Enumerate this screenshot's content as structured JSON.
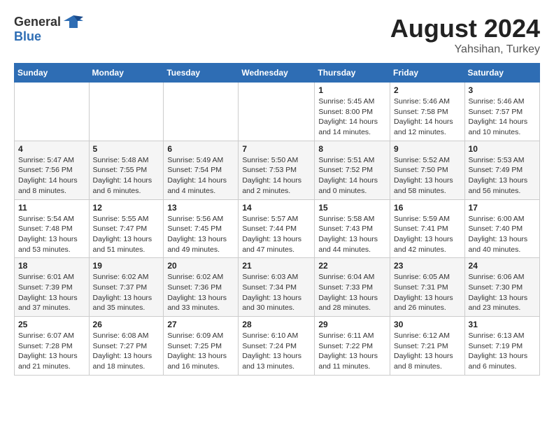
{
  "header": {
    "logo_general": "General",
    "logo_blue": "Blue",
    "title": "August 2024",
    "location": "Yahsihan, Turkey"
  },
  "weekdays": [
    "Sunday",
    "Monday",
    "Tuesday",
    "Wednesday",
    "Thursday",
    "Friday",
    "Saturday"
  ],
  "weeks": [
    [
      {
        "day": "",
        "sunrise": "",
        "sunset": "",
        "daylight": ""
      },
      {
        "day": "",
        "sunrise": "",
        "sunset": "",
        "daylight": ""
      },
      {
        "day": "",
        "sunrise": "",
        "sunset": "",
        "daylight": ""
      },
      {
        "day": "",
        "sunrise": "",
        "sunset": "",
        "daylight": ""
      },
      {
        "day": "1",
        "sunrise": "Sunrise: 5:45 AM",
        "sunset": "Sunset: 8:00 PM",
        "daylight": "Daylight: 14 hours and 14 minutes."
      },
      {
        "day": "2",
        "sunrise": "Sunrise: 5:46 AM",
        "sunset": "Sunset: 7:58 PM",
        "daylight": "Daylight: 14 hours and 12 minutes."
      },
      {
        "day": "3",
        "sunrise": "Sunrise: 5:46 AM",
        "sunset": "Sunset: 7:57 PM",
        "daylight": "Daylight: 14 hours and 10 minutes."
      }
    ],
    [
      {
        "day": "4",
        "sunrise": "Sunrise: 5:47 AM",
        "sunset": "Sunset: 7:56 PM",
        "daylight": "Daylight: 14 hours and 8 minutes."
      },
      {
        "day": "5",
        "sunrise": "Sunrise: 5:48 AM",
        "sunset": "Sunset: 7:55 PM",
        "daylight": "Daylight: 14 hours and 6 minutes."
      },
      {
        "day": "6",
        "sunrise": "Sunrise: 5:49 AM",
        "sunset": "Sunset: 7:54 PM",
        "daylight": "Daylight: 14 hours and 4 minutes."
      },
      {
        "day": "7",
        "sunrise": "Sunrise: 5:50 AM",
        "sunset": "Sunset: 7:53 PM",
        "daylight": "Daylight: 14 hours and 2 minutes."
      },
      {
        "day": "8",
        "sunrise": "Sunrise: 5:51 AM",
        "sunset": "Sunset: 7:52 PM",
        "daylight": "Daylight: 14 hours and 0 minutes."
      },
      {
        "day": "9",
        "sunrise": "Sunrise: 5:52 AM",
        "sunset": "Sunset: 7:50 PM",
        "daylight": "Daylight: 13 hours and 58 minutes."
      },
      {
        "day": "10",
        "sunrise": "Sunrise: 5:53 AM",
        "sunset": "Sunset: 7:49 PM",
        "daylight": "Daylight: 13 hours and 56 minutes."
      }
    ],
    [
      {
        "day": "11",
        "sunrise": "Sunrise: 5:54 AM",
        "sunset": "Sunset: 7:48 PM",
        "daylight": "Daylight: 13 hours and 53 minutes."
      },
      {
        "day": "12",
        "sunrise": "Sunrise: 5:55 AM",
        "sunset": "Sunset: 7:47 PM",
        "daylight": "Daylight: 13 hours and 51 minutes."
      },
      {
        "day": "13",
        "sunrise": "Sunrise: 5:56 AM",
        "sunset": "Sunset: 7:45 PM",
        "daylight": "Daylight: 13 hours and 49 minutes."
      },
      {
        "day": "14",
        "sunrise": "Sunrise: 5:57 AM",
        "sunset": "Sunset: 7:44 PM",
        "daylight": "Daylight: 13 hours and 47 minutes."
      },
      {
        "day": "15",
        "sunrise": "Sunrise: 5:58 AM",
        "sunset": "Sunset: 7:43 PM",
        "daylight": "Daylight: 13 hours and 44 minutes."
      },
      {
        "day": "16",
        "sunrise": "Sunrise: 5:59 AM",
        "sunset": "Sunset: 7:41 PM",
        "daylight": "Daylight: 13 hours and 42 minutes."
      },
      {
        "day": "17",
        "sunrise": "Sunrise: 6:00 AM",
        "sunset": "Sunset: 7:40 PM",
        "daylight": "Daylight: 13 hours and 40 minutes."
      }
    ],
    [
      {
        "day": "18",
        "sunrise": "Sunrise: 6:01 AM",
        "sunset": "Sunset: 7:39 PM",
        "daylight": "Daylight: 13 hours and 37 minutes."
      },
      {
        "day": "19",
        "sunrise": "Sunrise: 6:02 AM",
        "sunset": "Sunset: 7:37 PM",
        "daylight": "Daylight: 13 hours and 35 minutes."
      },
      {
        "day": "20",
        "sunrise": "Sunrise: 6:02 AM",
        "sunset": "Sunset: 7:36 PM",
        "daylight": "Daylight: 13 hours and 33 minutes."
      },
      {
        "day": "21",
        "sunrise": "Sunrise: 6:03 AM",
        "sunset": "Sunset: 7:34 PM",
        "daylight": "Daylight: 13 hours and 30 minutes."
      },
      {
        "day": "22",
        "sunrise": "Sunrise: 6:04 AM",
        "sunset": "Sunset: 7:33 PM",
        "daylight": "Daylight: 13 hours and 28 minutes."
      },
      {
        "day": "23",
        "sunrise": "Sunrise: 6:05 AM",
        "sunset": "Sunset: 7:31 PM",
        "daylight": "Daylight: 13 hours and 26 minutes."
      },
      {
        "day": "24",
        "sunrise": "Sunrise: 6:06 AM",
        "sunset": "Sunset: 7:30 PM",
        "daylight": "Daylight: 13 hours and 23 minutes."
      }
    ],
    [
      {
        "day": "25",
        "sunrise": "Sunrise: 6:07 AM",
        "sunset": "Sunset: 7:28 PM",
        "daylight": "Daylight: 13 hours and 21 minutes."
      },
      {
        "day": "26",
        "sunrise": "Sunrise: 6:08 AM",
        "sunset": "Sunset: 7:27 PM",
        "daylight": "Daylight: 13 hours and 18 minutes."
      },
      {
        "day": "27",
        "sunrise": "Sunrise: 6:09 AM",
        "sunset": "Sunset: 7:25 PM",
        "daylight": "Daylight: 13 hours and 16 minutes."
      },
      {
        "day": "28",
        "sunrise": "Sunrise: 6:10 AM",
        "sunset": "Sunset: 7:24 PM",
        "daylight": "Daylight: 13 hours and 13 minutes."
      },
      {
        "day": "29",
        "sunrise": "Sunrise: 6:11 AM",
        "sunset": "Sunset: 7:22 PM",
        "daylight": "Daylight: 13 hours and 11 minutes."
      },
      {
        "day": "30",
        "sunrise": "Sunrise: 6:12 AM",
        "sunset": "Sunset: 7:21 PM",
        "daylight": "Daylight: 13 hours and 8 minutes."
      },
      {
        "day": "31",
        "sunrise": "Sunrise: 6:13 AM",
        "sunset": "Sunset: 7:19 PM",
        "daylight": "Daylight: 13 hours and 6 minutes."
      }
    ]
  ]
}
